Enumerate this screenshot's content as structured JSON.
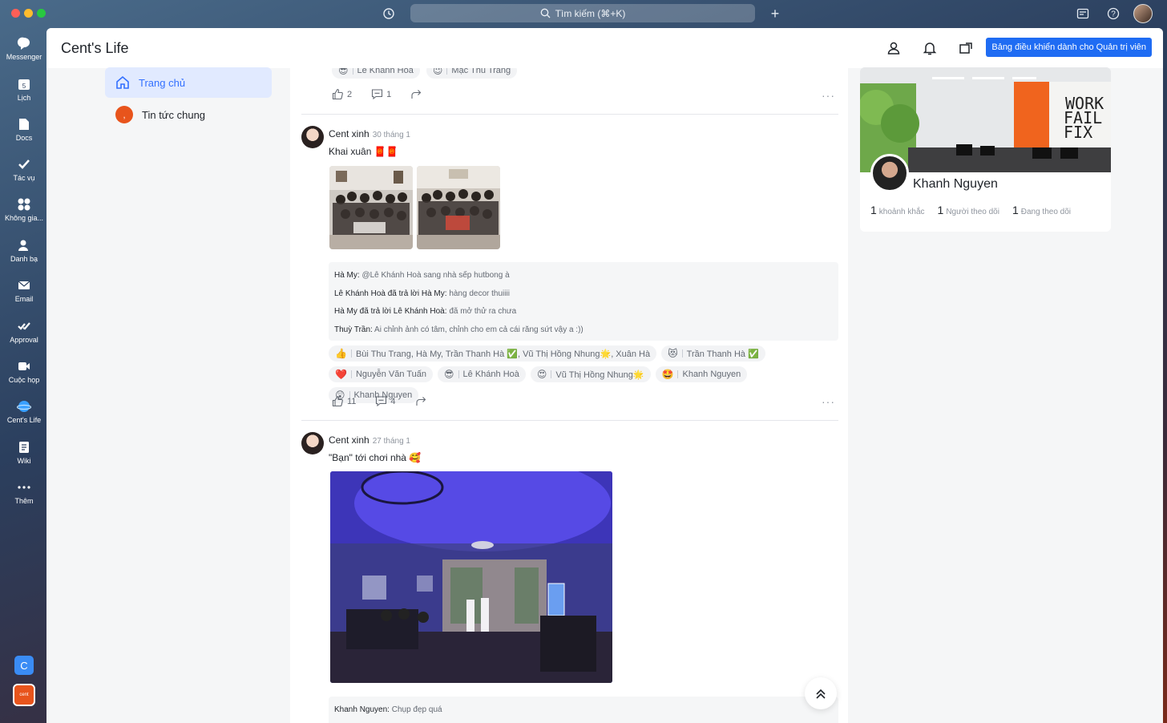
{
  "os": {
    "search_text": "Tìm kiếm (⌘+K)"
  },
  "rail": {
    "items": [
      {
        "label": "Messenger",
        "icon": "chat-bubble-icon"
      },
      {
        "label": "Lịch",
        "icon": "calendar-icon"
      },
      {
        "label": "Docs",
        "icon": "document-icon"
      },
      {
        "label": "Tác vụ",
        "icon": "checkmark-icon"
      },
      {
        "label": "Không gia...",
        "icon": "grid-icon"
      },
      {
        "label": "Danh bạ",
        "icon": "contacts-icon"
      },
      {
        "label": "Email",
        "icon": "mail-icon"
      },
      {
        "label": "Approval",
        "icon": "approval-icon"
      },
      {
        "label": "Cuộc họp",
        "icon": "video-camera-icon"
      },
      {
        "label": "Cent's Life",
        "icon": "planet-icon"
      },
      {
        "label": "Wiki",
        "icon": "wiki-icon"
      },
      {
        "label": "Thêm",
        "icon": "more-icon"
      }
    ],
    "workspace_c": "C",
    "workspace_cent": "cent"
  },
  "app": {
    "title": "Cent's Life",
    "admin_button": "Bảng điều khiển dành cho Quản trị viên"
  },
  "nav": {
    "items": [
      {
        "label": "Trang chủ"
      },
      {
        "label": "Tin tức chung"
      }
    ]
  },
  "feed": {
    "top_partial": {
      "reactors": [
        "Lê Khánh Hoà",
        "Mạc Thu Trang"
      ],
      "likes": "2",
      "comments": "1"
    },
    "posts": [
      {
        "author": "Cent xinh",
        "time": "30 tháng 1",
        "text": "Khai xuân 🧧🧧",
        "comments": [
          {
            "author": "Hà My:",
            "text": "@Lê Khánh Hoà sang nhà sếp hutbong à"
          },
          {
            "author": "Lê Khánh Hoà đã trả lời Hà My:",
            "text": "hàng decor thuiiii"
          },
          {
            "author": "Hà My đã trả lời Lê Khánh Hoà:",
            "text": "đã mở thử ra chưa"
          },
          {
            "author": "Thuỳ Trần:",
            "text": "Ai chỉnh ảnh có tâm, chỉnh cho em cả cái răng sứt vậy a :))"
          }
        ],
        "reactions": [
          {
            "emoji": "👍",
            "names": "Bùi Thu Trang,  Hà My,  Trần Thanh Hà ✅,  Vũ Thị Hồng Nhung🌟,  Xuân Hà"
          },
          {
            "emoji": "😻",
            "names": "Trần Thanh Hà ✅"
          },
          {
            "emoji": "❤️",
            "names": "Nguyễn Văn Tuấn"
          },
          {
            "emoji": "😎",
            "names": "Lê Khánh Hoà"
          },
          {
            "emoji": "😍",
            "names": "Vũ Thị Hồng Nhung🌟"
          },
          {
            "emoji": "🤩",
            "names": "Khanh Nguyen"
          },
          {
            "emoji": "😲",
            "names": "Khanh Nguyen"
          }
        ],
        "likes": "11",
        "comment_count": "4"
      },
      {
        "author": "Cent xinh",
        "time": "27 tháng 1",
        "text": "\"Bạn\" tới chơi nhà 🥰",
        "comments": [
          {
            "author": "Khanh Nguyen:",
            "text": "Chụp đẹp quá"
          }
        ]
      }
    ]
  },
  "profile": {
    "cover_text": "WORK\nFAIL\nFIX",
    "name": "Khanh Nguyen",
    "stats": [
      {
        "value": "1",
        "label": "khoảnh khắc"
      },
      {
        "value": "1",
        "label": "Người theo dõi"
      },
      {
        "value": "1",
        "label": "Đang theo dõi"
      }
    ]
  }
}
